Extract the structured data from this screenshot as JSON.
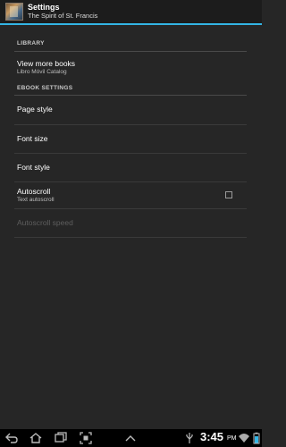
{
  "action_bar": {
    "title": "Settings",
    "subtitle": "The Spirit of St. Francis"
  },
  "sections": {
    "library": {
      "header": "LIBRARY",
      "view_more": {
        "label": "View more books",
        "sub": "Libro Móvil Catalog"
      }
    },
    "ebook": {
      "header": "EBOOK SETTINGS",
      "page_style": "Page style",
      "font_size": "Font size",
      "font_style": "Font style",
      "autoscroll": {
        "label": "Autoscroll",
        "sub": "Text autoscroll",
        "checked": false
      },
      "autoscroll_speed": "Autoscroll speed"
    }
  },
  "status": {
    "time": "3:45",
    "ampm": "PM"
  },
  "colors": {
    "accent": "#33b5e5",
    "background": "#262626"
  }
}
